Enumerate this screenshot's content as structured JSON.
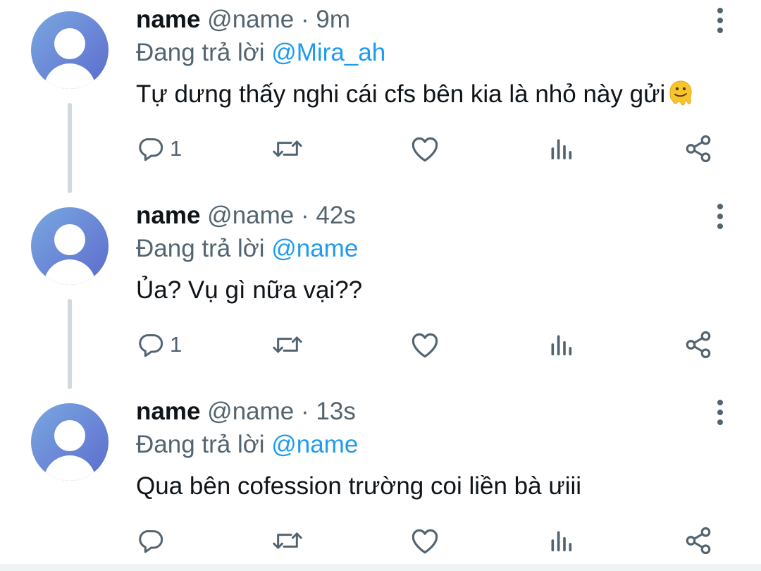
{
  "replies": [
    {
      "name": "name",
      "handle": "@name",
      "separator": "·",
      "time": "9m",
      "replying_prefix": "Đang trả lời",
      "replying_to": "@Mira_ah",
      "text": "Tự dưng thấy nghi cái cfs bên kia là nhỏ này gửi",
      "emoji": "melting-face-emoji",
      "reply_count": "1"
    },
    {
      "name": "name",
      "handle": "@name",
      "separator": "·",
      "time": "42s",
      "replying_prefix": "Đang trả lời",
      "replying_to": "@name",
      "text": "Ủa? Vụ gì nữa vại??",
      "reply_count": "1"
    },
    {
      "name": "name",
      "handle": "@name",
      "separator": "·",
      "time": "13s",
      "replying_prefix": "Đang trả lời",
      "replying_to": "@name",
      "text": "Qua bên cofession trường coi liền bà ưiii",
      "reply_count": ""
    }
  ],
  "icons": {
    "reply": "reply-icon",
    "retweet": "retweet-icon",
    "like": "heart-icon",
    "views": "analytics-icon",
    "share": "share-icon",
    "more": "more-vertical-icon"
  },
  "colors": {
    "text": "#0f1419",
    "secondary": "#536471",
    "link": "#1d9bf0",
    "thread_line": "#cfd9de"
  }
}
